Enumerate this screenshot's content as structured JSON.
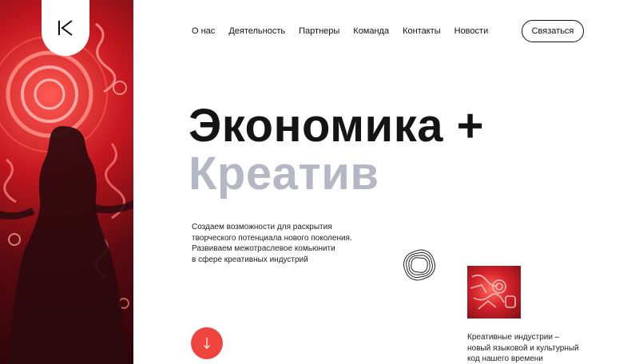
{
  "brand": {
    "logo_letter": "K"
  },
  "nav": {
    "items": [
      {
        "label": "О нас"
      },
      {
        "label": "Деятельность"
      },
      {
        "label": "Партнеры"
      },
      {
        "label": "Команда"
      },
      {
        "label": "Контакты"
      },
      {
        "label": "Новости"
      }
    ],
    "contact_label": "Связаться"
  },
  "hero": {
    "headline_line1": "Экономика +",
    "headline_line2": "Креатив",
    "intro_lines": [
      "Создаем возможности для раскрытия",
      "творческого потенциала нового поколения.",
      "Развиваем межотраслевое комьюнити",
      "в сфере креативных индустрий"
    ]
  },
  "feature": {
    "caption_lines": [
      "Креативные индустрии –",
      "новый языковой и культурный",
      "код нашего времени"
    ]
  },
  "icons": {
    "logo": "k-logo-icon",
    "scroll": "arrow-down-icon",
    "decoration": "squircle-rings-icon"
  },
  "colors": {
    "accent": "#f0453f",
    "headline_dark": "#141414",
    "headline_gray": "#b4b8c4",
    "image_red": "#c4161e"
  }
}
